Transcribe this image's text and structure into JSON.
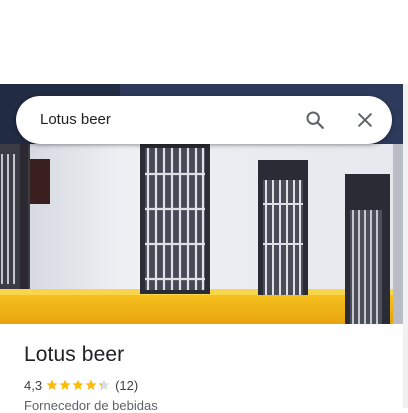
{
  "search": {
    "query": "Lotus beer",
    "search_icon": "search-icon",
    "close_icon": "close-icon"
  },
  "place": {
    "name": "Lotus beer",
    "rating": "4,3",
    "rating_value": 4.3,
    "reviews": "(12)",
    "category": "Fornecedor de bebidas"
  },
  "colors": {
    "star": "#fbbc04",
    "star_empty": "#dadce0",
    "wall_white": "#eceef2",
    "wall_yellow": "#f3b81a",
    "sign": "#1f2a44"
  }
}
